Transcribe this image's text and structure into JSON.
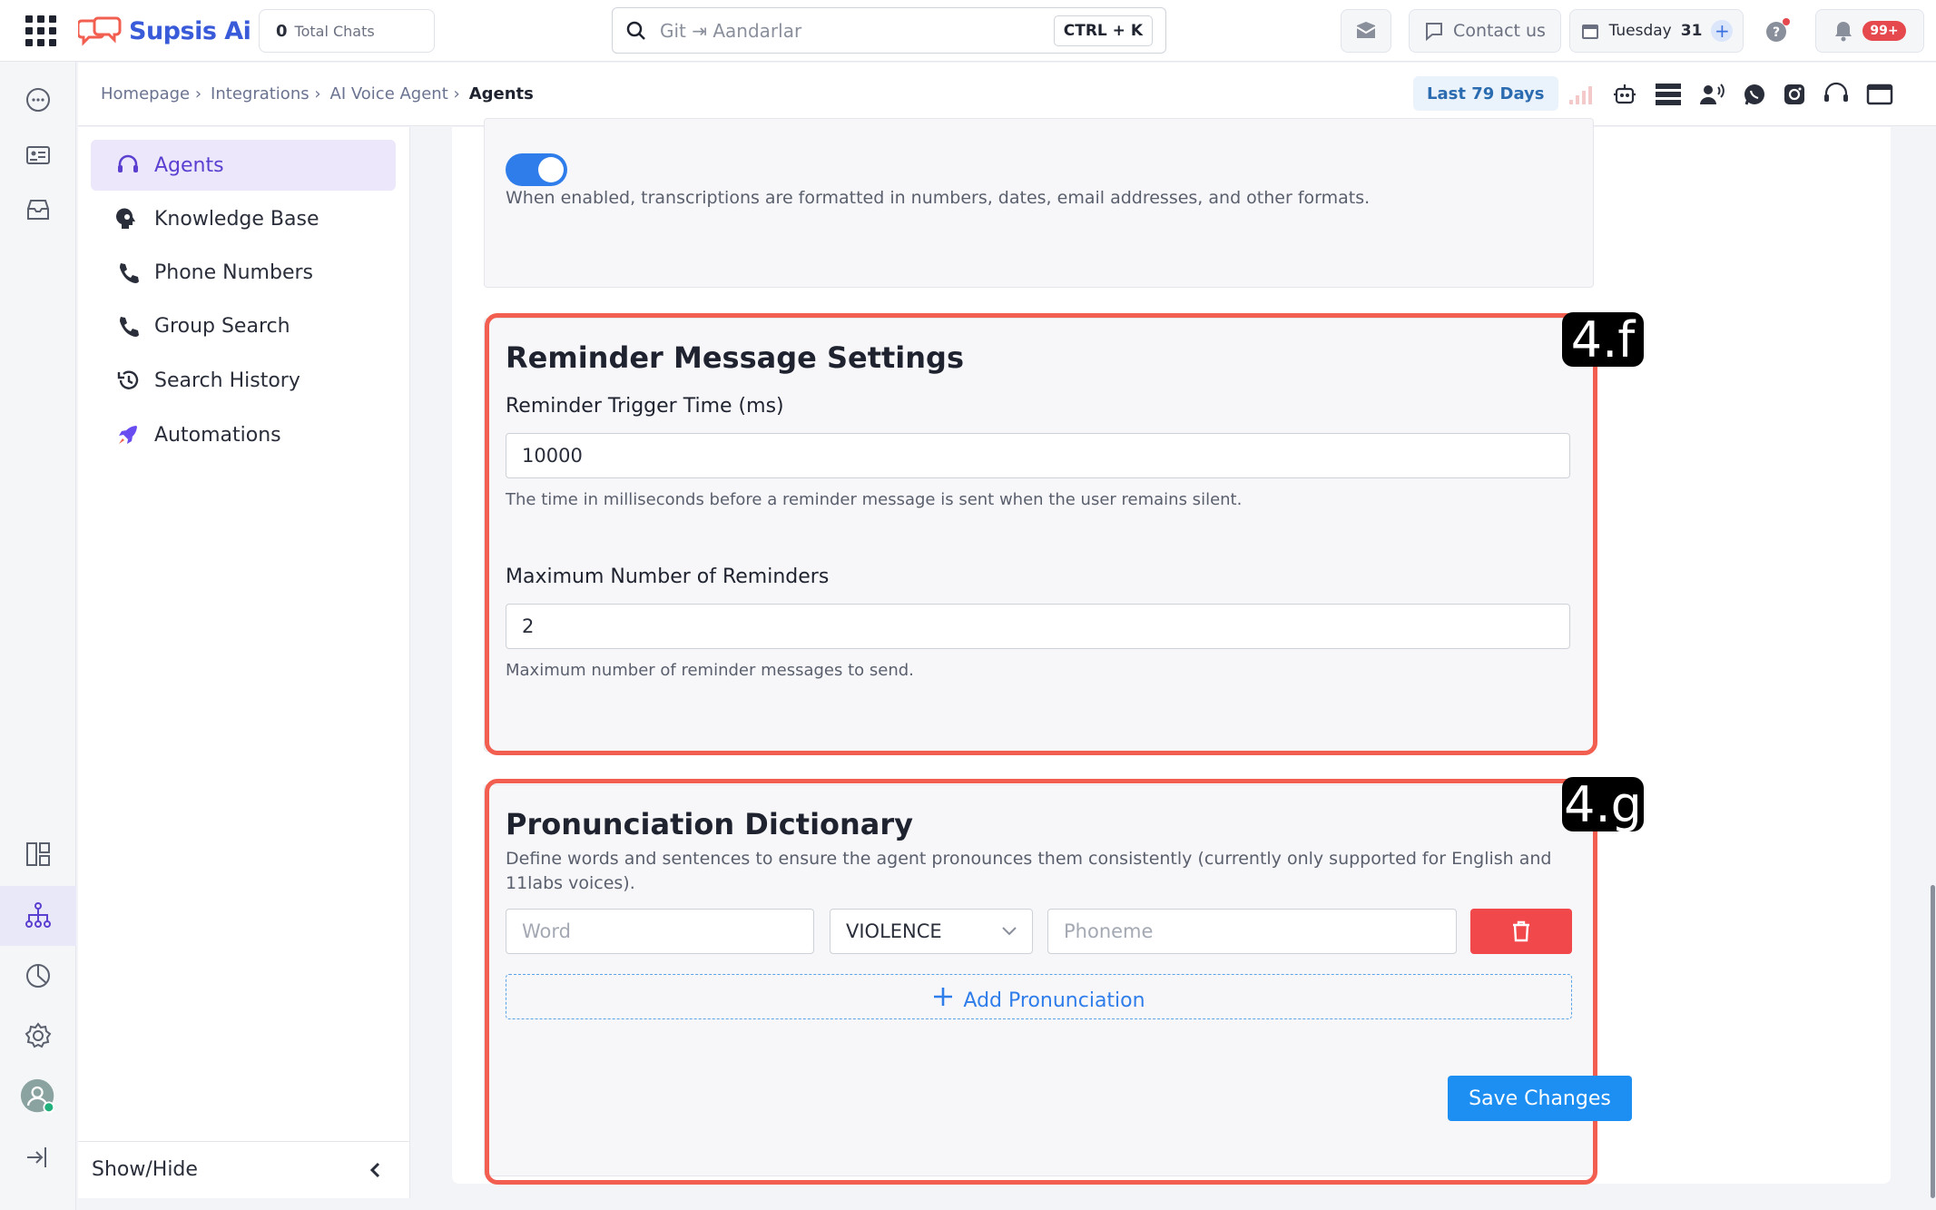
{
  "topbar": {
    "app_name": "Supsis Ai",
    "total_chats_count": "0",
    "total_chats_label": "Total Chats",
    "search_placeholder": "Git ⇥ Aandarlar",
    "search_shortcut": "CTRL + K",
    "contact_label": "Contact us",
    "date_day": "Tuesday",
    "date_num": "31",
    "notifications_badge": "99+"
  },
  "breadcrumb": {
    "items": [
      "Homepage ›",
      "Integrations ›",
      "AI Voice Agent ›"
    ],
    "current": "Agents",
    "date_range": "Last 79 Days"
  },
  "sidebar": {
    "items": [
      {
        "label": "Agents",
        "icon": "headset-icon"
      },
      {
        "label": "Knowledge Base",
        "icon": "brain-head-icon"
      },
      {
        "label": "Phone Numbers",
        "icon": "phone-icon"
      },
      {
        "label": "Group Search",
        "icon": "phone-icon"
      },
      {
        "label": "Search History",
        "icon": "history-icon"
      },
      {
        "label": "Automations",
        "icon": "rocket-icon"
      }
    ],
    "show_hide": "Show/Hide"
  },
  "formatting": {
    "toggle_on": true,
    "description": "When enabled, transcriptions are formatted in numbers, dates, email addresses, and other formats."
  },
  "reminder": {
    "tag": "4.f",
    "title": "Reminder Message Settings",
    "trigger_label": "Reminder Trigger Time (ms)",
    "trigger_value": "10000",
    "trigger_help": "The time in milliseconds before a reminder message is sent when the user remains silent.",
    "max_label": "Maximum Number of Reminders",
    "max_value": "2",
    "max_help": "Maximum number of reminder messages to send."
  },
  "pronunciation": {
    "tag": "4.g",
    "title": "Pronunciation Dictionary",
    "description": "Define words and sentences to ensure the agent pronounces them consistently (currently only supported for English and 11labs voices).",
    "word_placeholder": "Word",
    "alphabet_value": "VIOLENCE",
    "phoneme_placeholder": "Phoneme",
    "add_label": "Add Pronunciation"
  },
  "actions": {
    "save_label": "Save Changes"
  },
  "colors": {
    "accent": "#2f7dea",
    "highlight": "#f25f50",
    "delete": "#f0484b",
    "active_nav": "#5b3fd1"
  }
}
